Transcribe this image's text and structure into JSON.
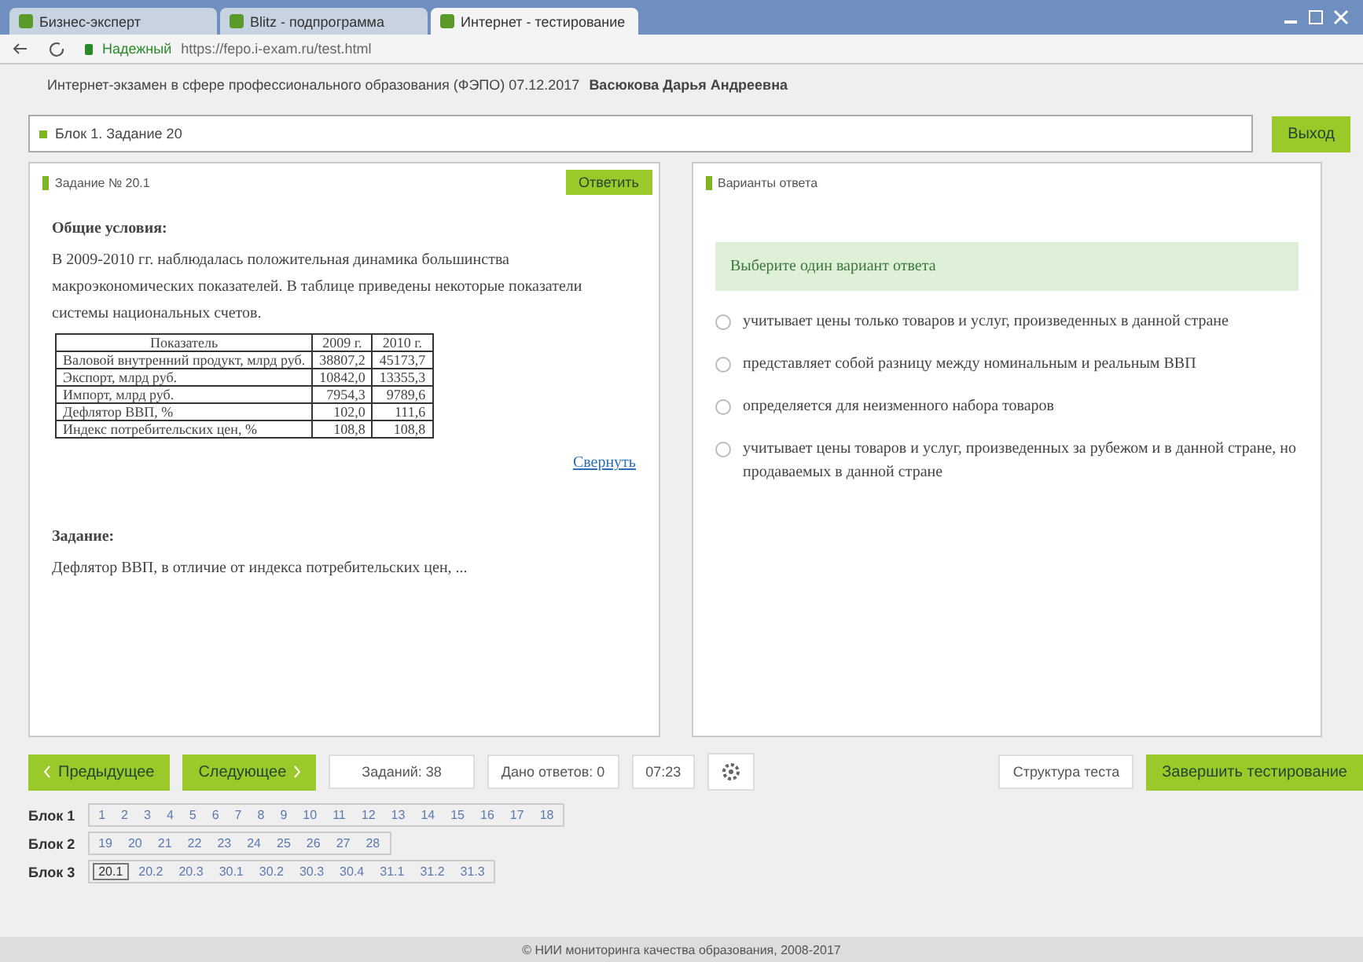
{
  "browser": {
    "tabs": [
      {
        "label": "Бизнес-эксперт",
        "selected": false
      },
      {
        "label": "Blitz - подпрограмма",
        "selected": false
      },
      {
        "label": "Интернет - тестирование",
        "selected": true
      }
    ],
    "address": {
      "secure_label": "Надежный",
      "url": "https://fepo.i-exam.ru/test.html"
    }
  },
  "info": {
    "text": "Интернет-экзамен в сфере профессионального образования (ФЭПО) 07.12.2017",
    "user": "Васюкова Дарья Андреевна"
  },
  "block_field": {
    "value": "Блок 1. Задание 20"
  },
  "top_button": "Выход",
  "task_panel": {
    "title": "Задание № 20.1",
    "answer_button": "Ответить",
    "conditions_heading": "Общие условия:",
    "conditions": "В 2009-2010 гг. наблюдалась положительная динамика большинства макроэкономических показателей. В таблице приведены некоторые показатели системы национальных счетов.",
    "table": {
      "columns": [
        "Показатель",
        "2009 г.",
        "2010 г."
      ],
      "rows": [
        [
          "Валовой внутренний продукт, млрд руб.",
          "38807,2",
          "45173,7"
        ],
        [
          "Экспорт, млрд руб.",
          "10842,0",
          "13355,3"
        ],
        [
          "Импорт, млрд руб.",
          "7954,3",
          "9789,6"
        ],
        [
          "Дефлятор ВВП, %",
          "102,0",
          "111,6"
        ],
        [
          "Индекс потребительских цен, %",
          "108,8",
          "108,8"
        ]
      ]
    },
    "collapse_link": "Свернуть",
    "task_heading": "Задание:",
    "task_text": "Дефлятор ВВП, в отличие от индекса потребительских цен, ..."
  },
  "answer_panel": {
    "title": "Варианты ответа",
    "hint": "Выберите один вариант ответа",
    "options": [
      {
        "text": "учитывает цены только товаров и услуг, произведенных в данной стране",
        "checked": false
      },
      {
        "text": "представляет собой разницу между номинальным и реальным ВВП",
        "checked": false
      },
      {
        "text": "определяется для неизменного набора товаров",
        "checked": false
      },
      {
        "text": "учитывает цены товаров и услуг, произведенных за рубежом и в данной стране, но продаваемых в данной стране",
        "checked": false
      }
    ]
  },
  "nav": {
    "prev": "Предыдущее",
    "next": "Следующее",
    "tasks_count": "Заданий: 38",
    "answered": "Дано ответов: 0",
    "timer": "07:23",
    "structure": "Структура теста",
    "finish": "Завершить тестирование"
  },
  "blocks": [
    {
      "label": "Блок 1",
      "items": [
        {
          "label": "1",
          "selected": false
        },
        {
          "label": "2",
          "selected": false
        },
        {
          "label": "3",
          "selected": false
        },
        {
          "label": "4",
          "selected": false
        },
        {
          "label": "5",
          "selected": false
        },
        {
          "label": "6",
          "selected": false
        },
        {
          "label": "7",
          "selected": false
        },
        {
          "label": "8",
          "selected": false
        },
        {
          "label": "9",
          "selected": false
        },
        {
          "label": "10",
          "selected": false
        },
        {
          "label": "11",
          "selected": false
        },
        {
          "label": "12",
          "selected": false
        },
        {
          "label": "13",
          "selected": false
        },
        {
          "label": "14",
          "selected": false
        },
        {
          "label": "15",
          "selected": false
        },
        {
          "label": "16",
          "selected": false
        },
        {
          "label": "17",
          "selected": false
        },
        {
          "label": "18",
          "selected": false
        }
      ]
    },
    {
      "label": "Блок 2",
      "items": [
        {
          "label": "19",
          "selected": false
        },
        {
          "label": "20",
          "selected": false
        },
        {
          "label": "21",
          "selected": false
        },
        {
          "label": "22",
          "selected": false
        },
        {
          "label": "23",
          "selected": false
        },
        {
          "label": "24",
          "selected": false
        },
        {
          "label": "25",
          "selected": false
        },
        {
          "label": "26",
          "selected": false
        },
        {
          "label": "27",
          "selected": false
        },
        {
          "label": "28",
          "selected": false
        }
      ]
    },
    {
      "label": "Блок 3",
      "items": [
        {
          "label": "20.1",
          "selected": true
        },
        {
          "label": "20.2",
          "selected": false
        },
        {
          "label": "20.3",
          "selected": false
        },
        {
          "label": "30.1",
          "selected": false
        },
        {
          "label": "30.2",
          "selected": false
        },
        {
          "label": "30.3",
          "selected": false
        },
        {
          "label": "30.4",
          "selected": false
        },
        {
          "label": "31.1",
          "selected": false
        },
        {
          "label": "31.2",
          "selected": false
        },
        {
          "label": "31.3",
          "selected": false
        }
      ]
    }
  ],
  "footer": "© НИИ мониторинга качества образования, 2008-2017"
}
